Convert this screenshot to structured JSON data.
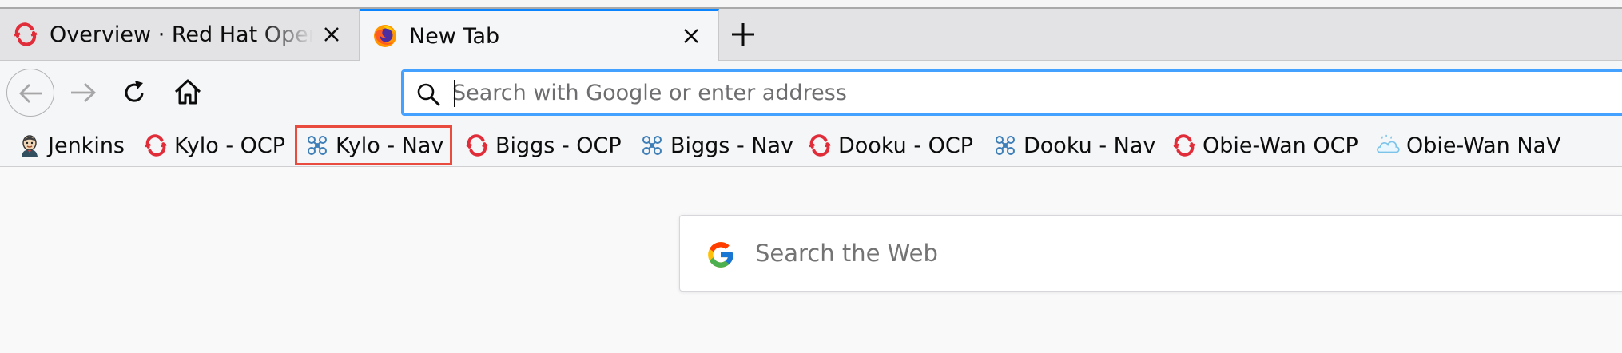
{
  "tabs": [
    {
      "title": "Overview · Red Hat OpenShift",
      "icon": "openshift-icon",
      "active": false
    },
    {
      "title": "New Tab",
      "icon": "firefox-icon",
      "active": true
    }
  ],
  "navbar": {
    "url_placeholder": "Search with Google or enter address",
    "url_value": ""
  },
  "bookmarks": [
    {
      "label": "Jenkins",
      "icon": "jenkins-icon"
    },
    {
      "label": "Kylo - OCP",
      "icon": "openshift-icon"
    },
    {
      "label": "Kylo - Nav",
      "icon": "navigator-icon",
      "highlighted": true
    },
    {
      "label": "Biggs - OCP",
      "icon": "openshift-icon"
    },
    {
      "label": "Biggs - Nav",
      "icon": "navigator-icon"
    },
    {
      "label": "Dooku - OCP",
      "icon": "openshift-icon"
    },
    {
      "label": "Dooku - Nav",
      "icon": "navigator-icon"
    },
    {
      "label": "Obie-Wan OCP",
      "icon": "openshift-icon"
    },
    {
      "label": "Obie-Wan NaV",
      "icon": "cloud-icon"
    }
  ],
  "content": {
    "search_placeholder": "Search the Web",
    "search_icon": "google-icon"
  },
  "colors": {
    "accent": "#0a84ff",
    "url_focus": "#45a1ff",
    "highlight": "#e94c3f",
    "openshift_red": "#e12d39"
  }
}
